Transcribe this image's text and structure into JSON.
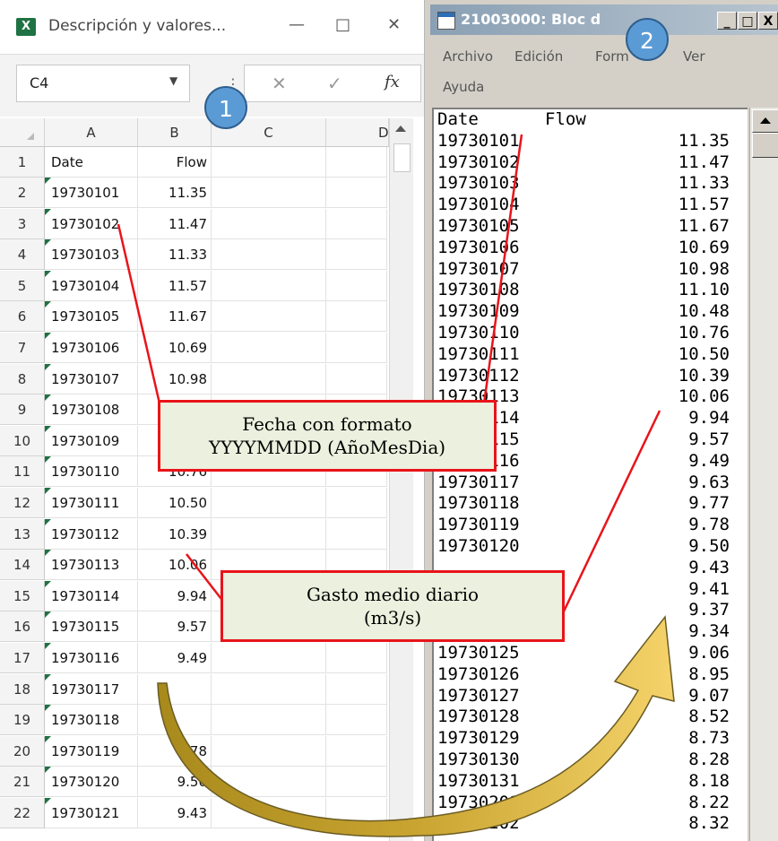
{
  "excel": {
    "title": "Descripción y valores...",
    "minimize": "—",
    "maximize": "□",
    "close": "✕",
    "name_box": "C4",
    "formula_sep": "⋮",
    "cancel_icon": "✕",
    "enter_icon": "✓",
    "fx_label": "fx",
    "columns": [
      "A",
      "B",
      "C",
      "D"
    ],
    "header_row": {
      "row": "1",
      "a": "Date",
      "b": "Flow"
    },
    "rows": [
      {
        "row": "2",
        "a": "19730101",
        "b": "11.35"
      },
      {
        "row": "3",
        "a": "19730102",
        "b": "11.47"
      },
      {
        "row": "4",
        "a": "19730103",
        "b": "11.33"
      },
      {
        "row": "5",
        "a": "19730104",
        "b": "11.57"
      },
      {
        "row": "6",
        "a": "19730105",
        "b": "11.67"
      },
      {
        "row": "7",
        "a": "19730106",
        "b": "10.69"
      },
      {
        "row": "8",
        "a": "19730107",
        "b": "10.98"
      },
      {
        "row": "9",
        "a": "19730108",
        "b": ""
      },
      {
        "row": "10",
        "a": "19730109",
        "b": ""
      },
      {
        "row": "11",
        "a": "19730110",
        "b": "10.76"
      },
      {
        "row": "12",
        "a": "19730111",
        "b": "10.50"
      },
      {
        "row": "13",
        "a": "19730112",
        "b": "10.39"
      },
      {
        "row": "14",
        "a": "19730113",
        "b": "10.06"
      },
      {
        "row": "15",
        "a": "19730114",
        "b": "9.94"
      },
      {
        "row": "16",
        "a": "19730115",
        "b": "9.57"
      },
      {
        "row": "17",
        "a": "19730116",
        "b": "9.49"
      },
      {
        "row": "18",
        "a": "19730117",
        "b": ""
      },
      {
        "row": "19",
        "a": "19730118",
        "b": ""
      },
      {
        "row": "20",
        "a": "19730119",
        "b": "9.78"
      },
      {
        "row": "21",
        "a": "19730120",
        "b": "9.50"
      },
      {
        "row": "22",
        "a": "19730121",
        "b": "9.43"
      }
    ]
  },
  "notepad": {
    "title": "21003000: Bloc d",
    "minimize": "_",
    "maximize": "□",
    "close": "X",
    "menu": {
      "file": "Archivo",
      "edit": "Edición",
      "format": "Form",
      "view": "Ver",
      "help": "Ayuda"
    },
    "header_date": "Date",
    "header_flow": "Flow",
    "lines": [
      {
        "date": "19730101",
        "flow": "11.35"
      },
      {
        "date": "19730102",
        "flow": "11.47"
      },
      {
        "date": "19730103",
        "flow": "11.33"
      },
      {
        "date": "19730104",
        "flow": "11.57"
      },
      {
        "date": "19730105",
        "flow": "11.67"
      },
      {
        "date": "19730106",
        "flow": "10.69"
      },
      {
        "date": "19730107",
        "flow": "10.98"
      },
      {
        "date": "19730108",
        "flow": "11.10"
      },
      {
        "date": "19730109",
        "flow": "10.48"
      },
      {
        "date": "19730110",
        "flow": "10.76"
      },
      {
        "date": "19730111",
        "flow": "10.50"
      },
      {
        "date": "19730112",
        "flow": "10.39"
      },
      {
        "date": "19730113",
        "flow": "10.06"
      },
      {
        "date": "19730114",
        "flow": "9.94"
      },
      {
        "date": "19730115",
        "flow": "9.57"
      },
      {
        "date": "19730116",
        "flow": "9.49"
      },
      {
        "date": "19730117",
        "flow": "9.63"
      },
      {
        "date": "19730118",
        "flow": "9.77"
      },
      {
        "date": "19730119",
        "flow": "9.78"
      },
      {
        "date": "19730120",
        "flow": "9.50"
      },
      {
        "date": "",
        "flow": "9.43"
      },
      {
        "date": "",
        "flow": "9.41"
      },
      {
        "date": "",
        "flow": "9.37"
      },
      {
        "date": "",
        "flow": "9.34"
      },
      {
        "date": "19730125",
        "flow": "9.06"
      },
      {
        "date": "19730126",
        "flow": "8.95"
      },
      {
        "date": "19730127",
        "flow": "9.07"
      },
      {
        "date": "19730128",
        "flow": "8.52"
      },
      {
        "date": "19730129",
        "flow": "8.73"
      },
      {
        "date": "19730130",
        "flow": "8.28"
      },
      {
        "date": "19730131",
        "flow": "8.18"
      },
      {
        "date": "19730201",
        "flow": "8.22"
      },
      {
        "date": "19730202",
        "flow": "8.32"
      }
    ]
  },
  "callouts": {
    "date_line1": "Fecha con formato",
    "date_line2": "YYYYMMDD (AñoMesDia)",
    "flow_line1": "Gasto medio diario",
    "flow_line2": "(m3/s)"
  },
  "badges": {
    "one": "1",
    "two": "2"
  },
  "colors": {
    "excel_green": "#1f7244",
    "callout_border": "#e8141a",
    "callout_fill": "#ebf1de",
    "badge_blue": "#5b9bd5",
    "arrow_gold": "#c9a431"
  }
}
